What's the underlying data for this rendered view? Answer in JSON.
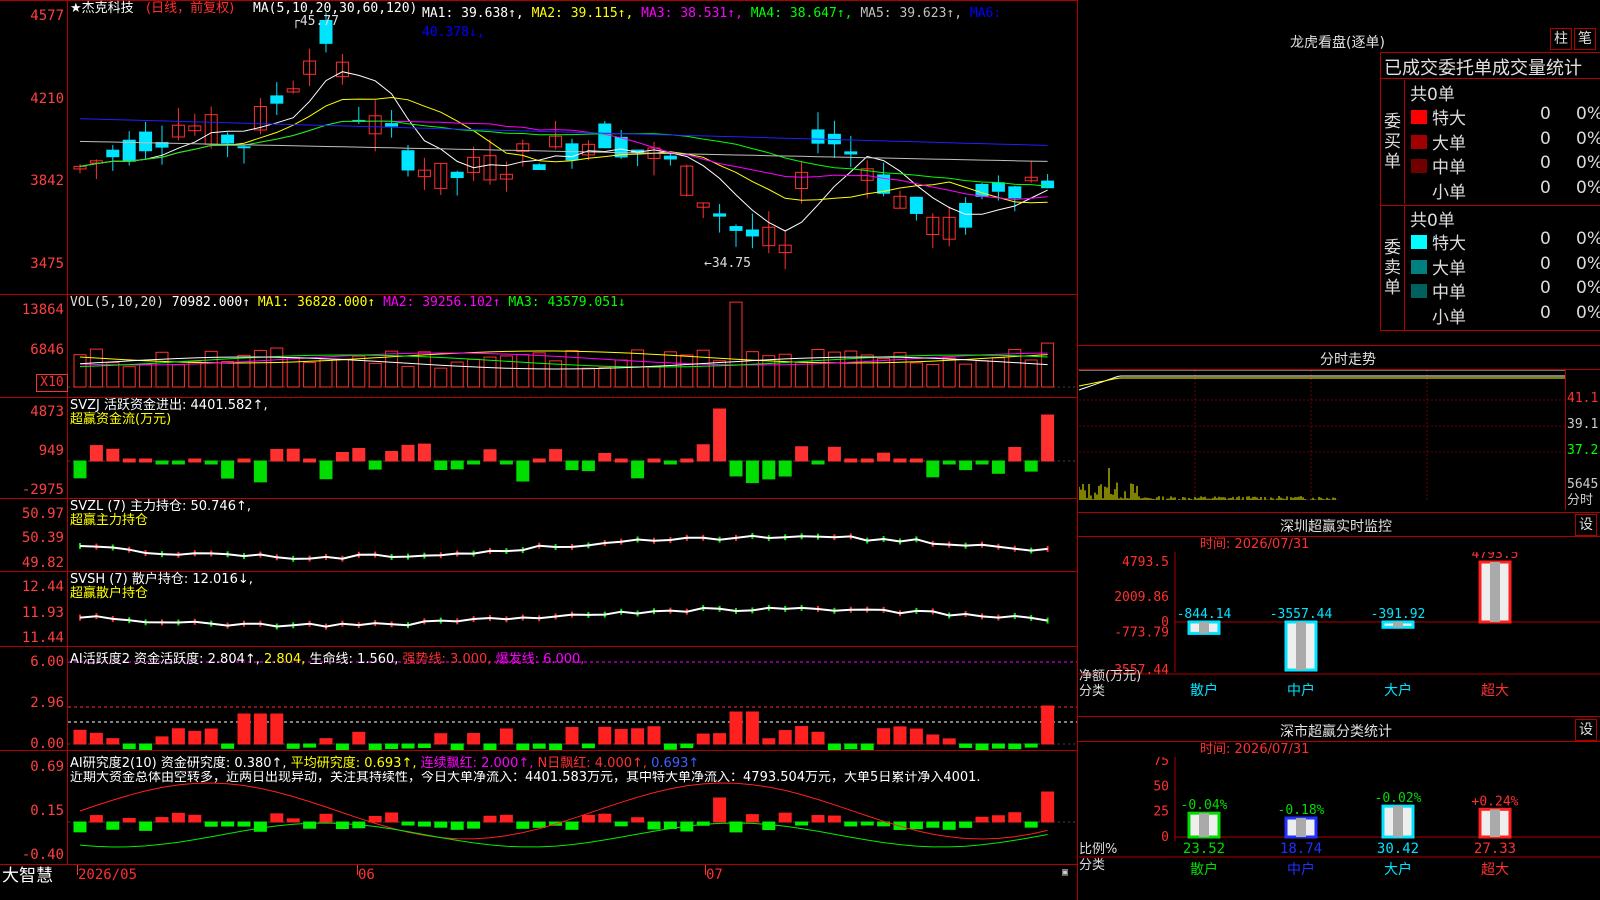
{
  "chart": {
    "title": "★杰克科技",
    "mode": "(日线，前复权)",
    "ma_text": "MA(5,10,20,30,60,120)",
    "ma_values": [
      {
        "label": "MA1: 39.638↑",
        "color": "#ffffff"
      },
      {
        "label": "MA2: 39.115↑",
        "color": "#ffff00"
      },
      {
        "label": "MA3: 38.531↑",
        "color": "#ff00ff"
      },
      {
        "label": "MA4: 38.647↑",
        "color": "#00ff00"
      },
      {
        "label": "MA5: 39.623↑",
        "color": "#c0c0c0"
      },
      {
        "label": "MA6: 40.378↓",
        "color": "#0000ff"
      }
    ],
    "high_mark": "45.77",
    "low_mark": "34.75",
    "price_axis": [
      "4577",
      "4210",
      "3842",
      "3475"
    ],
    "x_axis": [
      "2026/05",
      "06",
      "07"
    ],
    "logo": "大智慧"
  },
  "vol": {
    "header": "VOL(5,10,20)",
    "value": "70982.000↑",
    "ma1": "MA1: 36828.000↑",
    "ma2": "MA2: 39256.102↑",
    "ma3": "MA3: 43579.051↓",
    "axis": [
      "13864",
      "6846"
    ],
    "unit": "X10"
  },
  "svzj": {
    "header": "SVZJ  活跃资金进出: 4401.582↑,",
    "sub": "超赢资金流(万元)",
    "axis": [
      "4873",
      "949",
      "-2975"
    ]
  },
  "svzl": {
    "header": "SVZL (7) 主力持仓: 50.746↑,",
    "sub": "超赢主力持仓",
    "axis": [
      "50.97",
      "50.39",
      "49.82"
    ]
  },
  "svsh": {
    "header": "SVSH (7) 散户持仓: 12.016↓,",
    "sub": "超赢散户持仓",
    "axis": [
      "12.44",
      "11.93",
      "11.44"
    ]
  },
  "ai_active": {
    "header_a": "AI活跃度2 资金活跃度: 2.804↑,",
    "header_b": "2.804,",
    "header_c": "生命线: 1.560,",
    "header_d": "强势线: 3.000,",
    "header_e": "爆发线: 6.000,",
    "axis": [
      "6.00",
      "2.96",
      "0.00"
    ]
  },
  "ai_research": {
    "header_a": "AI研究度2(10) 资金研究度: 0.380↑,",
    "header_b": "平均研究度: 0.693↑,",
    "header_c": "连续飘红: 2.000↑,",
    "header_d": "N日飘红: 4.000↑,",
    "header_e": "0.693↑",
    "comment": "近期大资金总体由空转多，近两日出现异动，关注其持续性，今日大单净流入：4401.583万元，其中特大单净流入：4793.504万元，大单5日累计净入4001.",
    "axis": [
      "0.69",
      "0.15",
      "-0.40"
    ]
  },
  "longhu": {
    "title": "龙虎看盘(逐单)",
    "btn_bar": "柱",
    "btn_order": "笔",
    "tab": "已成交委托单成交量统计",
    "buy_label": "委买单",
    "sell_label": "委卖单",
    "buy_total": "共0单",
    "sell_total": "共0单",
    "buy_rows": [
      {
        "name": "特大",
        "count": "0",
        "pct": "0%",
        "color": "#ff0000"
      },
      {
        "name": "大单",
        "count": "0",
        "pct": "0%",
        "color": "#a00000"
      },
      {
        "name": "中单",
        "count": "0",
        "pct": "0%",
        "color": "#700000"
      },
      {
        "name": "小单",
        "count": "0",
        "pct": "0%",
        "color": "#000000"
      }
    ],
    "sell_rows": [
      {
        "name": "特大",
        "count": "0",
        "pct": "0%",
        "color": "#00ffff"
      },
      {
        "name": "大单",
        "count": "0",
        "pct": "0%",
        "color": "#008080"
      },
      {
        "name": "中单",
        "count": "0",
        "pct": "0%",
        "color": "#006060"
      },
      {
        "name": "小单",
        "count": "0",
        "pct": "0%",
        "color": "#000000"
      }
    ]
  },
  "intraday": {
    "title": "分时走势",
    "axis": [
      "41.1",
      "39.1",
      "37.2"
    ],
    "vol": "5645",
    "vol_label": "分时"
  },
  "monitor": {
    "title": "深圳超赢实时监控",
    "btn": "设",
    "time": "时间: 2026/07/31",
    "axis": [
      "4793.5",
      "2009.86",
      "0",
      "-773.79",
      "-3557.44"
    ],
    "ylabel": "净额(万元)",
    "xlabel": "分类",
    "bars": [
      {
        "name": "散户",
        "label": "-844.14",
        "value": -844.14
      },
      {
        "name": "中户",
        "label": "-3557.44",
        "value": -3557.44
      },
      {
        "name": "大户",
        "label": "-391.92",
        "value": -391.92
      },
      {
        "name": "超大",
        "label": "4793.5",
        "value": 4793.5
      }
    ]
  },
  "classify": {
    "title": "深市超赢分类统计",
    "btn": "设",
    "time": "时间: 2026/07/31",
    "axis": [
      "75",
      "50",
      "25",
      "0"
    ],
    "ylabel": "比例%",
    "xlabel": "分类",
    "bars": [
      {
        "name": "散户",
        "pct": "23.52",
        "chg": "-0.04%",
        "value": 23.52
      },
      {
        "name": "中户",
        "pct": "18.74",
        "chg": "-0.18%",
        "value": 18.74
      },
      {
        "name": "大户",
        "pct": "30.42",
        "chg": "-0.02%",
        "value": 30.42
      },
      {
        "name": "超大",
        "pct": "27.33",
        "chg": "+0.24%",
        "value": 27.33
      }
    ]
  }
}
